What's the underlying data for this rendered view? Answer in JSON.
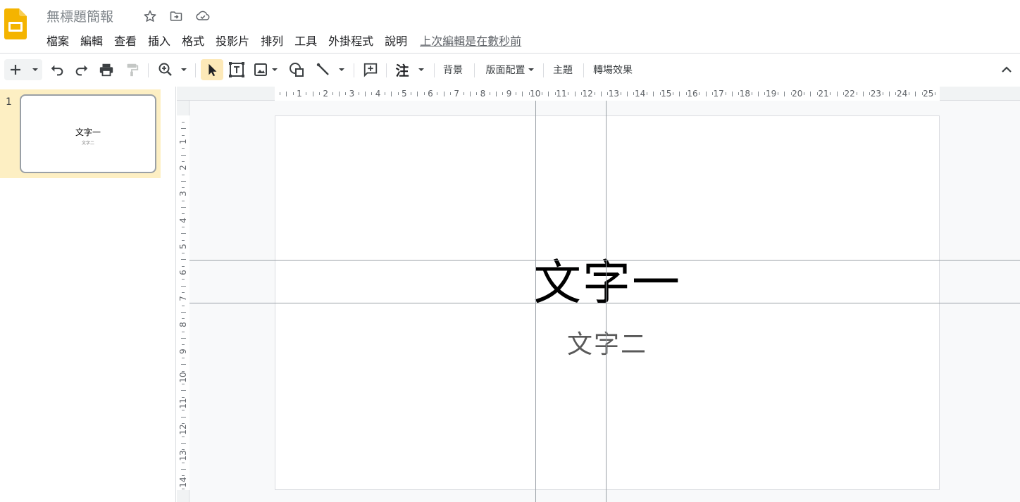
{
  "app": {
    "doc_title": "無標題簡報",
    "logo_icon": "slides-logo-icon",
    "colors": {
      "logo": "#f4b400",
      "selected_slide": "#fdefc3",
      "active_tool": "#fde9b8"
    }
  },
  "menu": {
    "items": [
      {
        "label": "檔案",
        "name": "menu-file"
      },
      {
        "label": "編輯",
        "name": "menu-edit"
      },
      {
        "label": "查看",
        "name": "menu-view"
      },
      {
        "label": "插入",
        "name": "menu-insert"
      },
      {
        "label": "格式",
        "name": "menu-format"
      },
      {
        "label": "投影片",
        "name": "menu-slide"
      },
      {
        "label": "排列",
        "name": "menu-arrange"
      },
      {
        "label": "工具",
        "name": "menu-tools"
      },
      {
        "label": "外掛程式",
        "name": "menu-addons"
      },
      {
        "label": "說明",
        "name": "menu-help"
      }
    ],
    "last_edit": "上次編輯是在數秒前"
  },
  "toolbar": {
    "note": "注",
    "background": "背景",
    "layout": "版面配置",
    "theme": "主題",
    "transition": "轉場效果"
  },
  "filmstrip": {
    "slides": [
      {
        "number": "1",
        "title": "文字一",
        "subtitle": "文字二"
      }
    ]
  },
  "rulers": {
    "horizontal": [
      "1",
      "2",
      "3",
      "4",
      "5",
      "6",
      "7",
      "8",
      "9",
      "10",
      "11",
      "12",
      "13",
      "14",
      "15",
      "16",
      "17",
      "18",
      "19",
      "20",
      "21",
      "22",
      "23",
      "24",
      "25"
    ],
    "vertical": [
      "1",
      "2",
      "3",
      "4",
      "5",
      "6",
      "7",
      "8",
      "9",
      "10",
      "11",
      "12",
      "13",
      "14"
    ]
  },
  "slide": {
    "title": "文字一",
    "subtitle": "文字二"
  }
}
